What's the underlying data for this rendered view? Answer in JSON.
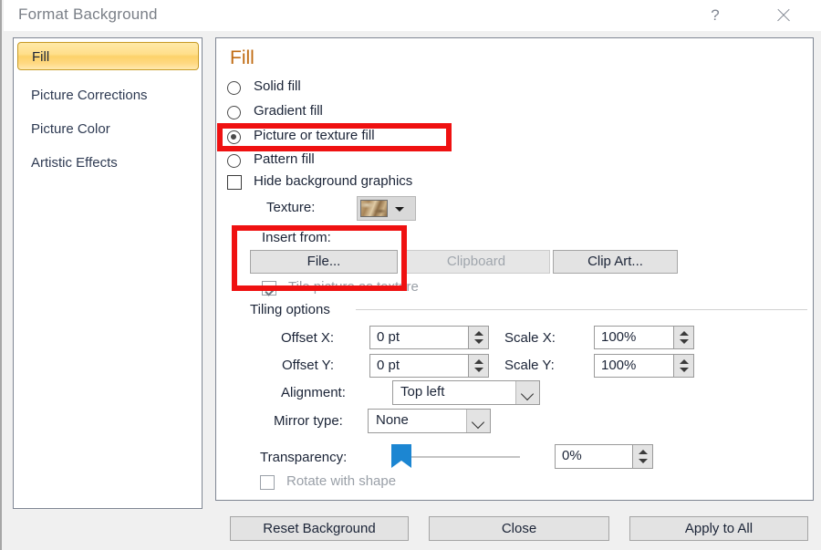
{
  "titlebar": {
    "title": "Format Background",
    "help_label": "?",
    "help_icon": "question-mark-icon",
    "close_icon": "close-icon"
  },
  "sidebar": {
    "items": [
      {
        "label": "Fill",
        "selected": true
      },
      {
        "label": "Picture Corrections",
        "selected": false
      },
      {
        "label": "Picture Color",
        "selected": false
      },
      {
        "label": "Artistic Effects",
        "selected": false
      }
    ]
  },
  "pane": {
    "title": "Fill",
    "fill_options": [
      {
        "label": "Solid fill",
        "accel": "S",
        "checked": false
      },
      {
        "label": "Gradient fill",
        "accel": "G",
        "checked": false
      },
      {
        "label": "Picture or texture fill",
        "accel": "P",
        "checked": true
      },
      {
        "label": "Pattern fill",
        "accel": "a",
        "checked": false
      }
    ],
    "hide_background": {
      "label": "Hide background graphics",
      "accel": "H",
      "checked": false
    },
    "texture": {
      "label": "Texture:",
      "accel": "u",
      "swatch_icon": "texture-swatch-icon",
      "dropdown_icon": "caret-down-icon"
    },
    "insert_from": {
      "label": "Insert from:",
      "accel": "r",
      "buttons": [
        {
          "label": "File...",
          "accel": "F",
          "enabled": true
        },
        {
          "label": "Clipboard",
          "accel": "C",
          "enabled": false
        },
        {
          "label": "Clip Art...",
          "accel": "r",
          "enabled": true
        }
      ]
    },
    "tile_picture": {
      "label": "Tile picture as texture",
      "accel": "i",
      "checked": true,
      "enabled": false
    },
    "tiling_options": {
      "group_label": "Tiling options",
      "fields": [
        {
          "label": "Offset X:",
          "accel": "O",
          "value": "0 pt"
        },
        {
          "label": "Offset Y:",
          "accel": "e",
          "value": "0 pt"
        },
        {
          "label": "Scale X:",
          "accel": "X",
          "value": "100%"
        },
        {
          "label": "Scale Y:",
          "accel": "Y",
          "value": "100%"
        }
      ],
      "alignment": {
        "label": "Alignment:",
        "accel": "l",
        "value": "Top left"
      },
      "mirror_type": {
        "label": "Mirror type:",
        "accel": "M",
        "value": "None"
      }
    },
    "transparency": {
      "label": "Transparency:",
      "accel": "T",
      "value": "0%",
      "slider_position": 0
    },
    "rotate_with_shape": {
      "label": "Rotate with shape",
      "accel": "w",
      "checked": false,
      "enabled": false
    }
  },
  "footer": {
    "buttons": [
      {
        "label": "Reset Background",
        "accel": "B"
      },
      {
        "label": "Close",
        "accel": ""
      },
      {
        "label": "Apply to All",
        "accel": "y"
      }
    ]
  },
  "annotations": {
    "highlight_color": "#ef1111",
    "boxes": [
      {
        "target": "picture-or-texture-fill-radio"
      },
      {
        "target": "insert-from-file-button"
      }
    ]
  }
}
